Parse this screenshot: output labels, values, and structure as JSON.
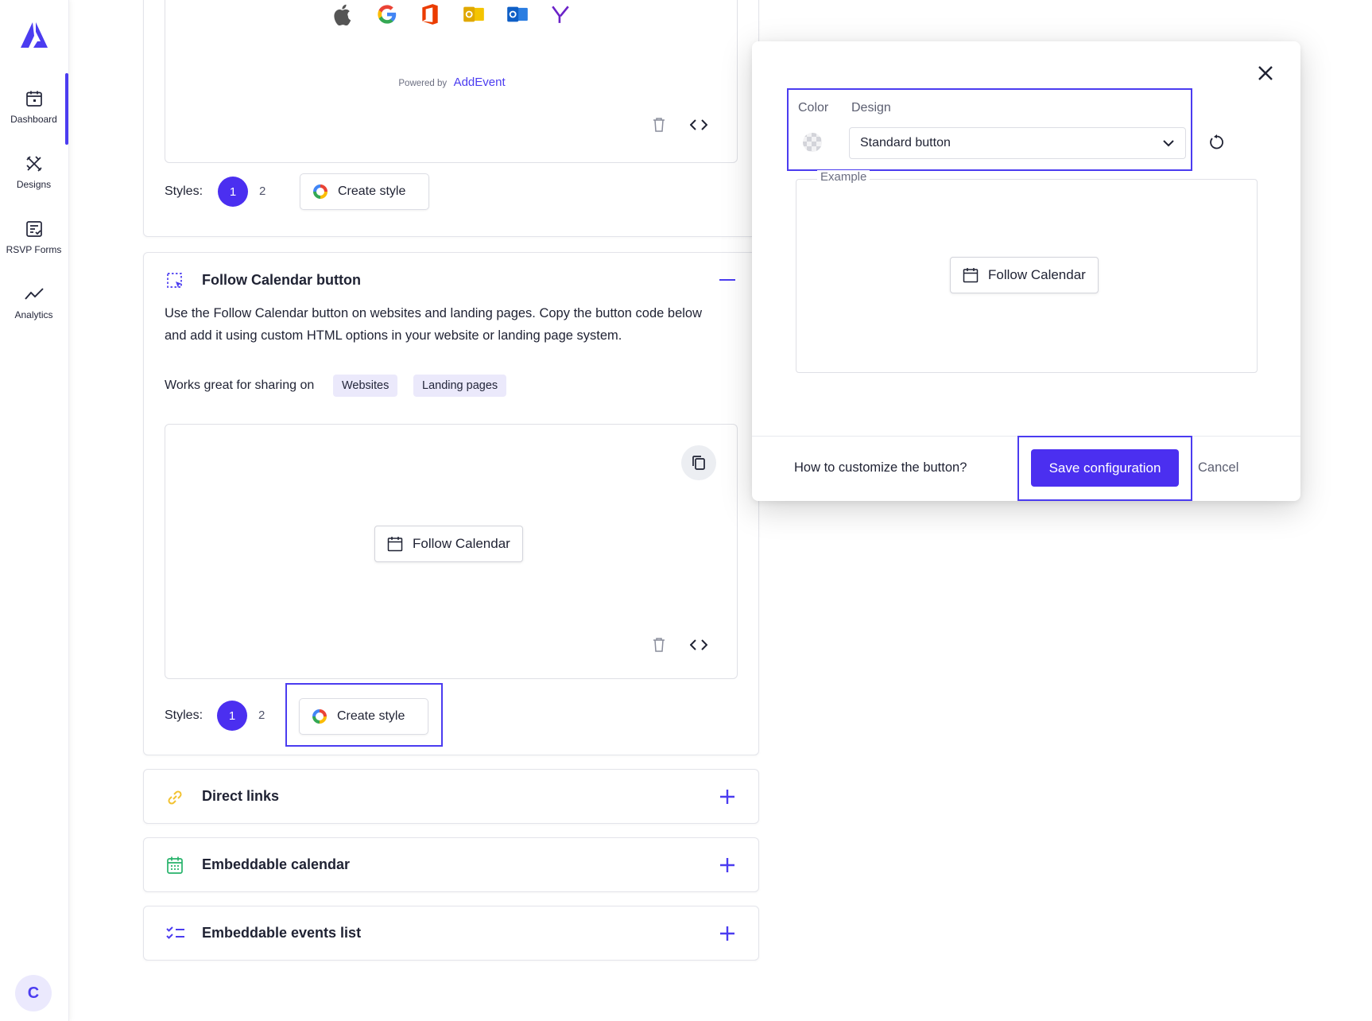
{
  "sidebar": {
    "items": [
      {
        "label": "Dashboard",
        "icon": "calendar-icon"
      },
      {
        "label": "Designs",
        "icon": "designs-icon"
      },
      {
        "label": "RSVP Forms",
        "icon": "rsvp-forms-icon"
      },
      {
        "label": "Analytics",
        "icon": "analytics-icon"
      }
    ],
    "avatar_initial": "C"
  },
  "top_card": {
    "provider_icons": [
      "apple-icon",
      "google-icon",
      "office365-icon",
      "outlook-icon",
      "outlook-com-icon",
      "yahoo-icon"
    ],
    "powered_by_prefix": "Powered by",
    "powered_by_brand": "AddEvent",
    "styles_label": "Styles:",
    "style_numbers": [
      "1",
      "2"
    ],
    "create_style_label": "Create style"
  },
  "follow_card": {
    "title": "Follow Calendar button",
    "description": "Use the Follow Calendar button on websites and landing pages. Copy the button code below and add it using custom HTML options in your website or landing page system.",
    "works_great_label": "Works great for sharing on",
    "tags": [
      "Websites",
      "Landing pages"
    ],
    "preview_button_label": "Follow Calendar",
    "styles_label": "Styles:",
    "style_numbers": [
      "1",
      "2"
    ],
    "create_style_label": "Create style"
  },
  "sections": [
    {
      "title": "Direct links",
      "icon": "link-icon",
      "icon_color": "#f2c230"
    },
    {
      "title": "Embeddable calendar",
      "icon": "calendar-grid-icon",
      "icon_color": "#27b36b"
    },
    {
      "title": "Embeddable events list",
      "icon": "checklist-icon",
      "icon_color": "#4b3cf0"
    }
  ],
  "modal": {
    "color_label": "Color",
    "design_label": "Design",
    "design_value": "Standard button",
    "example_label": "Example",
    "example_button_label": "Follow Calendar",
    "help_link": "How to customize the button?",
    "save_label": "Save configuration",
    "cancel_label": "Cancel"
  },
  "colors": {
    "accent": "#4b2ff0",
    "highlight_border": "#4b3cf0",
    "tag_bg": "#ebe9fb"
  }
}
